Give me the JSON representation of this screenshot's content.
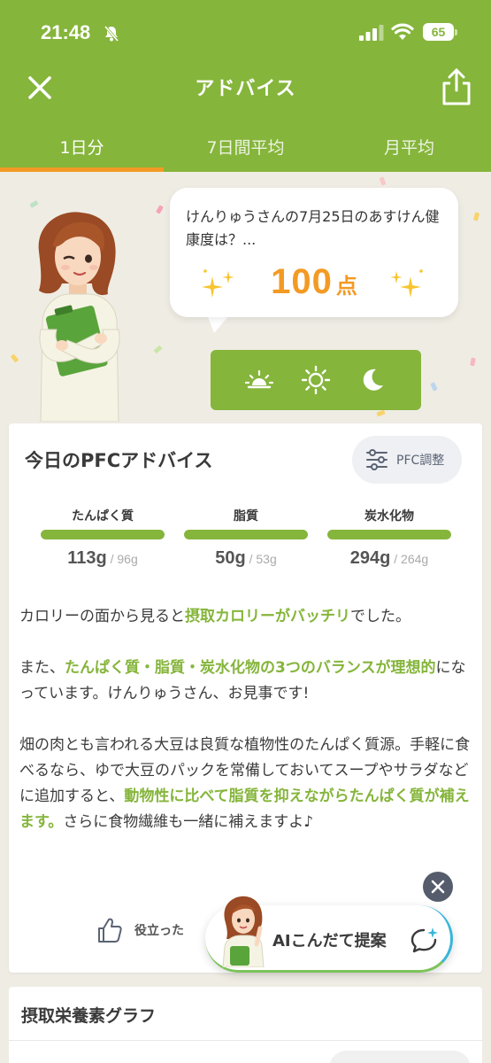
{
  "status_bar": {
    "time": "21:48",
    "battery": "65"
  },
  "header": {
    "title": "アドバイス"
  },
  "tabs": [
    {
      "label": "1日分",
      "active": true
    },
    {
      "label": "7日間平均",
      "active": false
    },
    {
      "label": "月平均",
      "active": false
    }
  ],
  "bubble": {
    "question": "けんりゅうさんの7月25日のあすけん健康度は？...",
    "score": "100",
    "unit": "点"
  },
  "time_of_day": [
    "sunrise-icon",
    "sun-icon",
    "moon-icon"
  ],
  "pfc": {
    "title": "今日のPFCアドバイス",
    "adjust_label": "PFC調整",
    "nutrients": [
      {
        "name": "たんぱく質",
        "actual": "113g",
        "target": " / 96g",
        "progress": 1.0
      },
      {
        "name": "脂質",
        "actual": "50g",
        "target": " / 53g",
        "progress": 1.0
      },
      {
        "name": "炭水化物",
        "actual": "294g",
        "target": " / 264g",
        "progress": 1.0
      }
    ]
  },
  "advice": {
    "p1_a": "カロリーの面から見ると",
    "p1_hl": "摂取カロリーがバッチリ",
    "p1_b": "でした。",
    "p2_a": "また、",
    "p2_hl": "たんぱく質・脂質・炭水化物の3つのバランスが理想的",
    "p2_b": "になっています。けんりゅうさん、お見事です!",
    "p3_a": "畑の肉とも言われる大豆は良質な植物性のたんぱく質源。手軽に食べるなら、ゆで大豆のパックを常備しておいてスープやサラダなどに追加すると、",
    "p3_hl": "動物性に比べて脂質を抑えながらたんぱく質が補えます。",
    "p3_b": "さらに食物繊維も一緒に補えますよ♪"
  },
  "helpful_label": "役立った",
  "ai_button": {
    "label": "AIこんだて提案"
  },
  "graph_section": {
    "title": "摂取栄養素グラフ"
  },
  "colors": {
    "brand_green": "#85b53b",
    "accent_orange": "#f39a24"
  }
}
